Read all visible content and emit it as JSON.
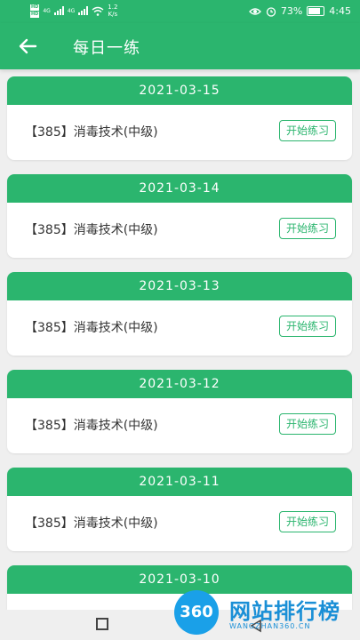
{
  "status_bar": {
    "hd1": "HD",
    "hd2": "HD",
    "net": "4G",
    "net2": "4G",
    "speed_value": "1.2",
    "speed_unit": "K/s",
    "battery": "73%",
    "time": "4:45"
  },
  "header": {
    "title": "每日一练"
  },
  "cards": [
    {
      "date": "2021-03-15",
      "course": "【385】消毒技术(中级)",
      "button": "开始练习"
    },
    {
      "date": "2021-03-14",
      "course": "【385】消毒技术(中级)",
      "button": "开始练习"
    },
    {
      "date": "2021-03-13",
      "course": "【385】消毒技术(中级)",
      "button": "开始练习"
    },
    {
      "date": "2021-03-12",
      "course": "【385】消毒技术(中级)",
      "button": "开始练习"
    },
    {
      "date": "2021-03-11",
      "course": "【385】消毒技术(中级)",
      "button": "开始练习"
    },
    {
      "date": "2021-03-10"
    }
  ],
  "watermark": {
    "logo_text": "360",
    "title": "网站排行榜",
    "subtitle": "WANGZHAN360.CN"
  },
  "colors": {
    "accent": "#2bb56e",
    "background": "#efefef",
    "watermark": "#1a8fd6"
  },
  "icons": {
    "back": "arrow-left-icon",
    "eye": "eye-icon",
    "alarm": "alarm-icon",
    "battery": "battery-icon",
    "wifi": "wifi-icon",
    "nav_home": "square-icon",
    "nav_back": "triangle-back-icon"
  }
}
